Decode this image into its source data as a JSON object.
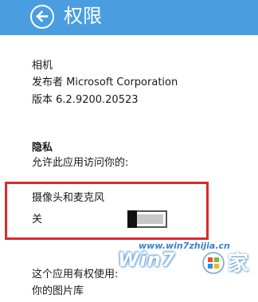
{
  "header": {
    "title": "权限",
    "back_icon": "back-arrow-icon",
    "background_color": "#4a9ee0"
  },
  "app_info": {
    "name": "相机",
    "publisher": "发布者 Microsoft Corporation",
    "version": "版本 6.2.9200.20523"
  },
  "privacy": {
    "heading": "隐私",
    "description": "允许此应用访问你的:"
  },
  "camera_setting": {
    "label": "摄像头和麦克风",
    "toggle_state_label": "关",
    "toggle_on": false,
    "highlight_color": "#d92b2b"
  },
  "permissions": {
    "title": "这个应用有权使用:",
    "items": [
      "你的图片库"
    ]
  },
  "watermark": {
    "url": "www.win7zhijia.cn",
    "brand": "Win7",
    "suffix": "家"
  }
}
